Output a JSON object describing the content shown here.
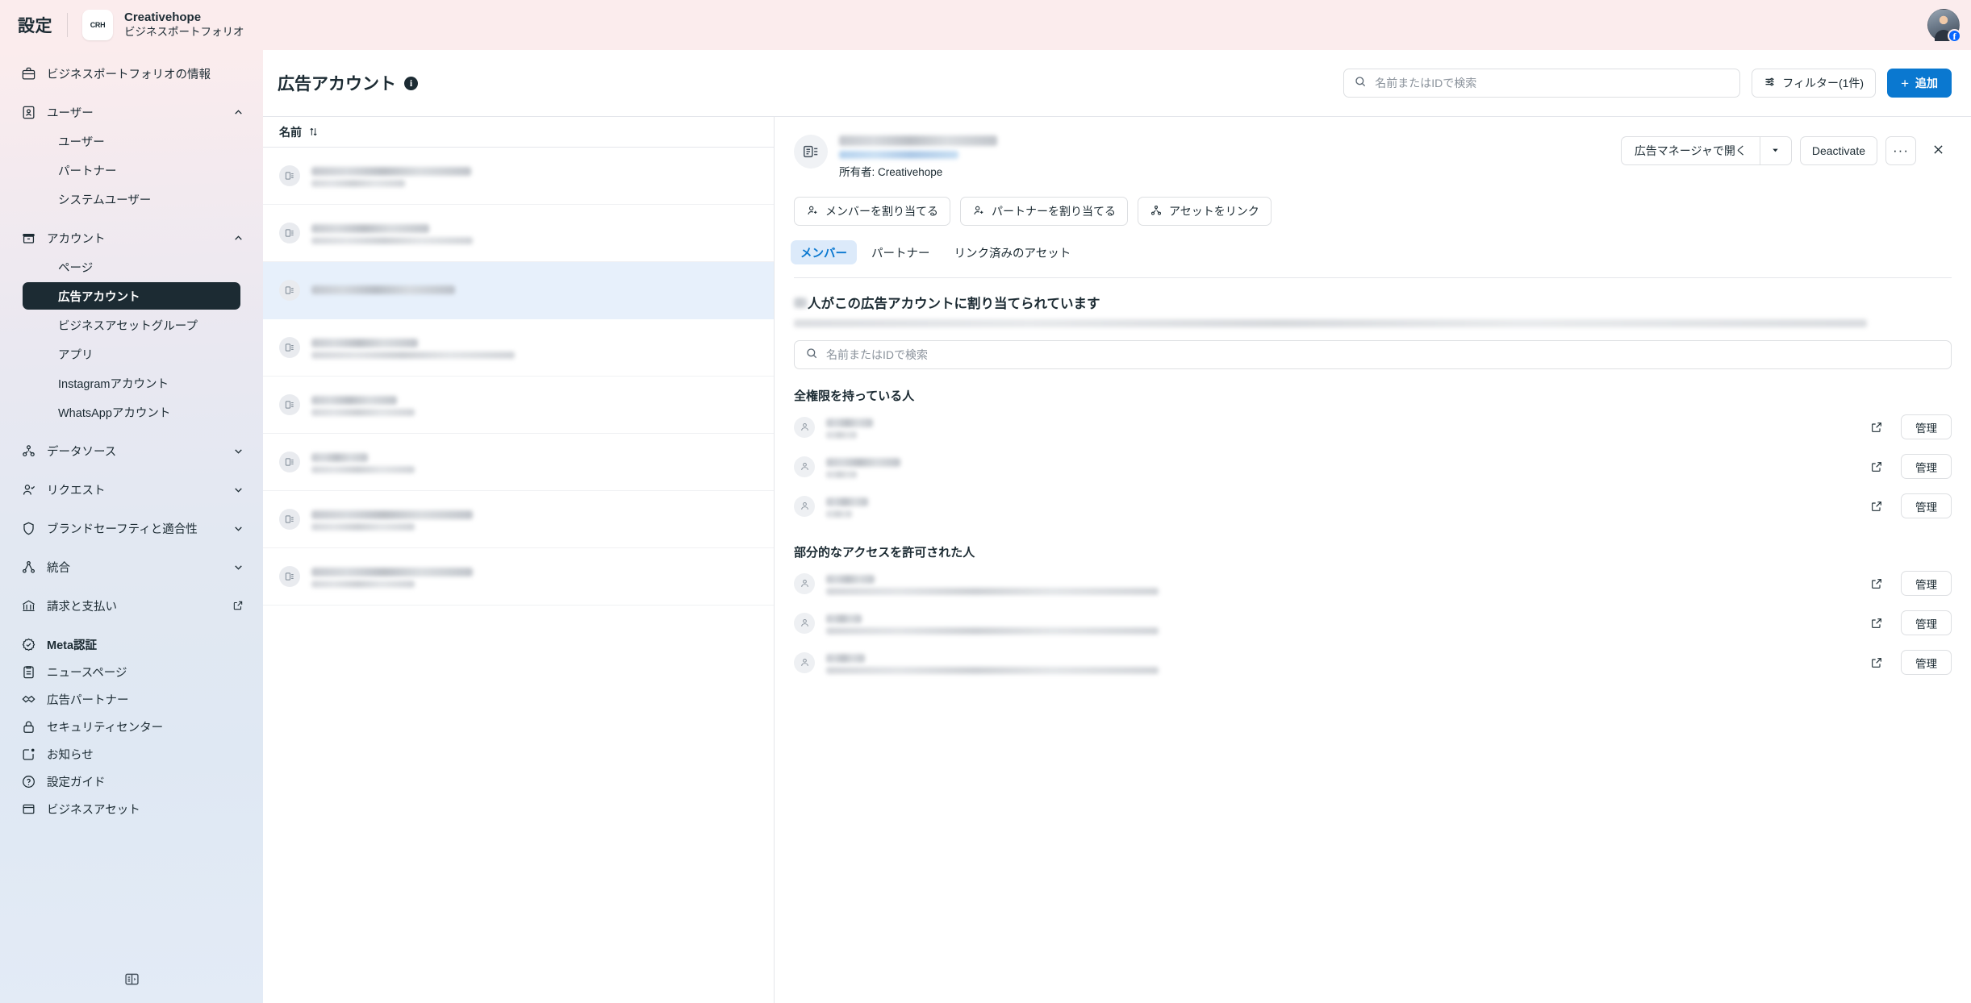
{
  "topbar": {
    "title": "設定",
    "logo_text": "CRH",
    "brand_name": "Creativehope",
    "brand_sub": "ビジネスポートフォリオ",
    "avatar_badge": "f"
  },
  "sidebar": {
    "items": [
      {
        "label": "ビジネスポートフォリオの情報",
        "icon": "briefcase-icon",
        "type": "item"
      },
      {
        "label": "ユーザー",
        "icon": "id-card-icon",
        "type": "group",
        "expanded": true
      },
      {
        "label": "ユーザー",
        "type": "sub"
      },
      {
        "label": "パートナー",
        "type": "sub"
      },
      {
        "label": "システムユーザー",
        "type": "sub"
      },
      {
        "label": "アカウント",
        "icon": "archive-icon",
        "type": "group",
        "expanded": true
      },
      {
        "label": "ページ",
        "type": "sub"
      },
      {
        "label": "広告アカウント",
        "type": "sub",
        "active": true
      },
      {
        "label": "ビジネスアセットグループ",
        "type": "sub"
      },
      {
        "label": "アプリ",
        "type": "sub"
      },
      {
        "label": "Instagramアカウント",
        "type": "sub"
      },
      {
        "label": "WhatsAppアカウント",
        "type": "sub"
      },
      {
        "label": "データソース",
        "icon": "nodes-icon",
        "type": "group",
        "expanded": false
      },
      {
        "label": "リクエスト",
        "icon": "user-check-icon",
        "type": "group",
        "expanded": false
      },
      {
        "label": "ブランドセーフティと適合性",
        "icon": "shield-icon",
        "type": "group",
        "expanded": false
      },
      {
        "label": "統合",
        "icon": "integrations-icon",
        "type": "group",
        "expanded": false
      },
      {
        "label": "請求と支払い",
        "icon": "bank-icon",
        "type": "item",
        "external": true
      },
      {
        "label": "Meta認証",
        "icon": "verified-icon",
        "type": "item",
        "bold": true
      },
      {
        "label": "ニュースページ",
        "icon": "clipboard-icon",
        "type": "item"
      },
      {
        "label": "広告パートナー",
        "icon": "handshake-icon",
        "type": "item"
      },
      {
        "label": "セキュリティセンター",
        "icon": "lock-icon",
        "type": "item"
      },
      {
        "label": "お知らせ",
        "icon": "notification-icon",
        "type": "item"
      },
      {
        "label": "設定ガイド",
        "icon": "question-icon",
        "type": "item"
      },
      {
        "label": "ビジネスアセット",
        "icon": "assets-icon",
        "type": "item"
      }
    ],
    "collapse_icon": "sidebar-collapse-icon"
  },
  "main": {
    "page_title": "広告アカウント",
    "info_icon": "info-icon",
    "search_placeholder": "名前またはIDで検索",
    "search_value": "",
    "filter_label": "フィルター(1件)",
    "add_label": "追加"
  },
  "list": {
    "column_header": "名前",
    "sort_icon": "sort-icon",
    "rows": [
      {
        "redacted": true,
        "lines": 2,
        "name_width": 198,
        "id_width": 116,
        "selected": false
      },
      {
        "redacted": true,
        "lines": 2,
        "name_width": 146,
        "id_width": 200,
        "selected": false
      },
      {
        "redacted": true,
        "lines": 1,
        "name_width": 178,
        "id_width": 0,
        "selected": true
      },
      {
        "redacted": true,
        "lines": 2,
        "name_width": 132,
        "id_width": 252,
        "selected": false
      },
      {
        "redacted": true,
        "lines": 2,
        "name_width": 106,
        "id_width": 128,
        "selected": false
      },
      {
        "redacted": true,
        "lines": 2,
        "name_width": 70,
        "id_width": 128,
        "selected": false
      },
      {
        "redacted": true,
        "lines": 2,
        "name_width": 200,
        "id_width": 128,
        "selected": false
      },
      {
        "redacted": true,
        "lines": 2,
        "name_width": 200,
        "id_width": 128,
        "selected": false
      }
    ]
  },
  "detail": {
    "account_icon": "ad-account-icon",
    "title_redacted": true,
    "id_redacted": true,
    "owner_label": "所有者: Creativehope",
    "open_in_ads_manager": "広告マネージャで開く",
    "dropdown_icon": "chevron-down-icon",
    "deactivate_label": "Deactivate",
    "more_label": "···",
    "close_icon": "close-icon",
    "assign_buttons": [
      {
        "label": "メンバーを割り当てる",
        "icon": "user-plus-icon"
      },
      {
        "label": "パートナーを割り当てる",
        "icon": "user-plus-icon"
      },
      {
        "label": "アセットをリンク",
        "icon": "link-asset-icon"
      }
    ],
    "tabs": [
      {
        "label": "メンバー",
        "active": true
      },
      {
        "label": "パートナー",
        "active": false
      },
      {
        "label": "リンク済みのアセット",
        "active": false
      }
    ],
    "assigned_count_redacted": true,
    "assigned_heading": "人がこの広告アカウントに割り当てられています",
    "assigned_desc_redacted": true,
    "member_search_placeholder": "名前またはIDで検索",
    "member_search_value": "",
    "sections": [
      {
        "title": "全権限を持っている人",
        "members": [
          {
            "redacted": true,
            "name_width": 58,
            "sub_width": 38,
            "sub_long": false,
            "external_icon": "external-link-icon",
            "manage_label": "管理"
          },
          {
            "redacted": true,
            "name_width": 92,
            "sub_width": 38,
            "sub_long": false,
            "external_icon": "external-link-icon",
            "manage_label": "管理"
          },
          {
            "redacted": true,
            "name_width": 52,
            "sub_width": 32,
            "sub_long": false,
            "external_icon": "external-link-icon",
            "manage_label": "管理"
          }
        ]
      },
      {
        "title": "部分的なアクセスを許可された人",
        "members": [
          {
            "redacted": true,
            "name_width": 60,
            "sub_width": 412,
            "sub_long": true,
            "external_icon": "external-link-icon",
            "manage_label": "管理"
          },
          {
            "redacted": true,
            "name_width": 44,
            "sub_width": 412,
            "sub_long": true,
            "external_icon": "external-link-icon",
            "manage_label": "管理"
          },
          {
            "redacted": true,
            "name_width": 48,
            "sub_width": 412,
            "sub_long": true,
            "external_icon": "external-link-icon",
            "manage_label": "管理"
          }
        ]
      }
    ]
  },
  "colors": {
    "accent_blue": "#0a78d0",
    "active_nav": "#1c2b33",
    "selected_row": "#e7f0fb",
    "topbar_bg": "#fbeced"
  }
}
